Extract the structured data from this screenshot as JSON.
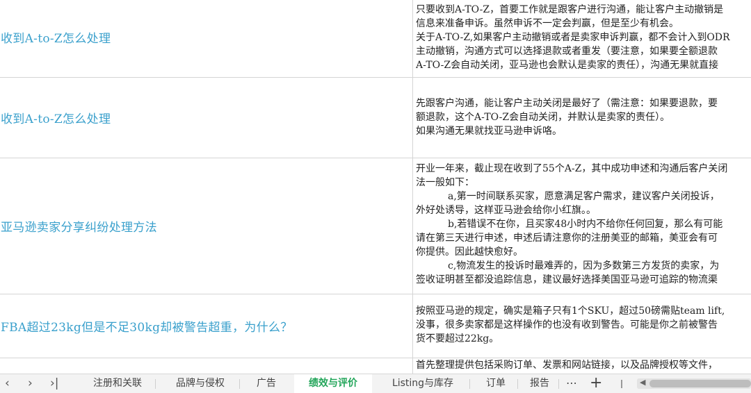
{
  "rows": [
    {
      "question": "收到A-to-Z怎么处理",
      "answer": [
        {
          "text": "只要收到A-TO-Z，首要工作就是跟客户进行沟通，能让客户主动撤销是",
          "indent": false
        },
        {
          "text": "信息来准备申诉。虽然申诉不一定会判赢，但是至少有机会。",
          "indent": false
        },
        {
          "text": "关于A-TO-Z,如果客户主动撤销或者是卖家申诉判赢，都不会计入到ODR",
          "indent": false
        },
        {
          "text": "主动撤销，沟通方式可以选择退款或者重发（要注意，如果要全额退款",
          "indent": false
        },
        {
          "text": "A-TO-Z会自动关闭，亚马逊也会默认是卖家的责任），沟通无果就直接",
          "indent": false
        }
      ]
    },
    {
      "question": "收到A-to-Z怎么处理",
      "answer": [
        {
          "text": "先跟客户沟通，能让客户主动关闭是最好了（需注意：如果要退款，要",
          "indent": false
        },
        {
          "text": "额退款，这个A-TO-Z会自动关闭，并默认是卖家的责任）。",
          "indent": false
        },
        {
          "text": "如果沟通无果就找亚马逊申诉咯。",
          "indent": false
        }
      ]
    },
    {
      "question": "亚马逊卖家分享纠纷处理方法",
      "answer": [
        {
          "text": "开业一年来，截止现在收到了55个A-Z，其中成功申述和沟通后客户关闭",
          "indent": false
        },
        {
          "text": "法一般如下：",
          "indent": false
        },
        {
          "text": "a,第一时间联系买家，愿意满足客户需求，建议客户关闭投诉，",
          "indent": true
        },
        {
          "text": "外好处诱导，这样亚马逊会给你小红旗。。",
          "indent": false
        },
        {
          "text": "b,若错误不在你，且买家48小时内不给你任何回复，那么有可能",
          "indent": true
        },
        {
          "text": "请在第三天进行申述，申述后请注意你的注册美亚的邮箱，美亚会有可",
          "indent": false
        },
        {
          "text": "你提供。因此越快愈好。",
          "indent": false
        },
        {
          "text": "c,物流发生的投诉时最难弄的，因为多数第三方发货的卖家，为",
          "indent": true
        },
        {
          "text": "签收证明甚至都没追踪信息，建议最好选择美国亚马逊可追踪的物流渠",
          "indent": false
        }
      ]
    },
    {
      "question": "FBA超过23kg但是不足30kg却被警告超重，为什么？",
      "answer": [
        {
          "text": "按照亚马逊的规定，确实是箱子只有1个SKU，超过50磅需贴team lift,",
          "indent": false
        },
        {
          "text": "没事，很多卖家都是这样操作的也没有收到警告。可能是你之前被警告",
          "indent": false
        },
        {
          "text": "货不要超过22kg。",
          "indent": false
        }
      ]
    },
    {
      "question": "",
      "answer": [
        {
          "text": "首先整理提供包括采购订单、发票和网站链接，以及品牌授权等文件，",
          "indent": false
        }
      ]
    }
  ],
  "tabbar": {
    "nav": {
      "first": "‹",
      "next": "›",
      "last": "›|"
    },
    "tabs": [
      {
        "label": "注册和关联",
        "active": false
      },
      {
        "label": "品牌与侵权",
        "active": false
      },
      {
        "label": "广告",
        "active": false
      },
      {
        "label": "绩效与评价",
        "active": true
      },
      {
        "label": "Listing与库存",
        "active": false
      },
      {
        "label": "订单",
        "active": false
      },
      {
        "label": "报告",
        "active": false
      }
    ],
    "more": "⋯",
    "add": "+"
  },
  "colors": {
    "question": "#3aa0cc",
    "active_tab": "#23a55a"
  }
}
